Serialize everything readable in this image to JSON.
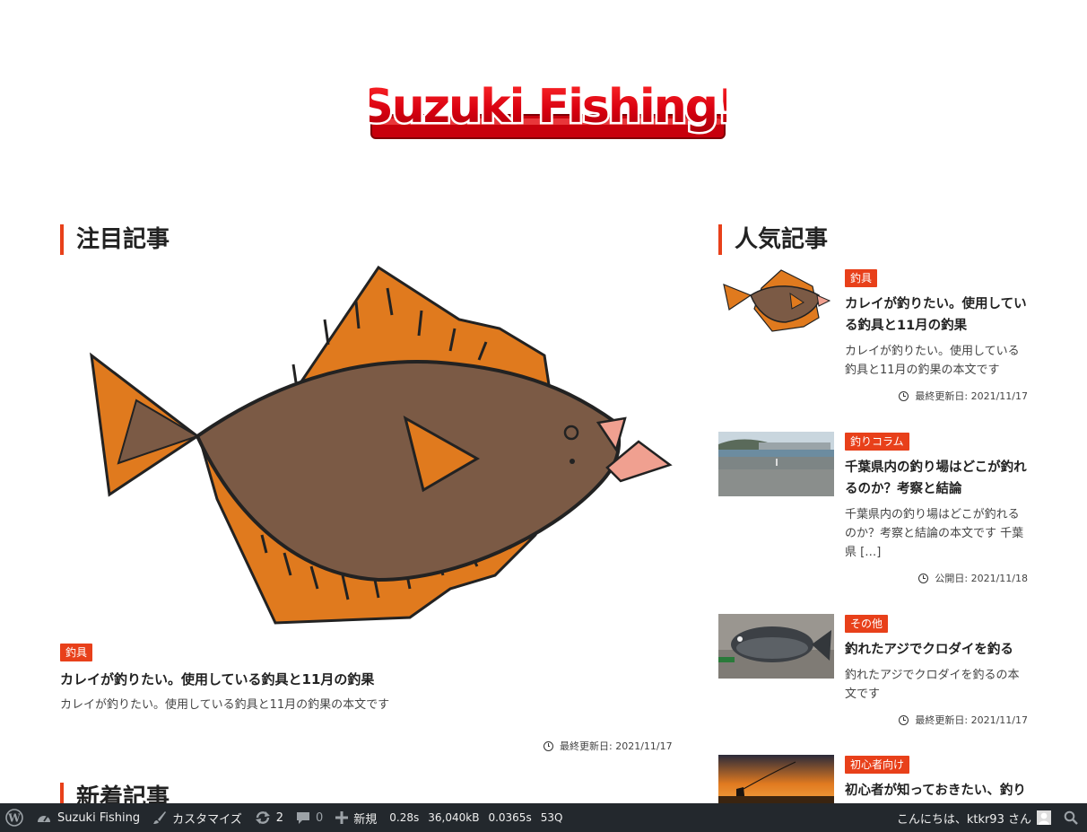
{
  "site": {
    "logo_text": "Suzuki Fishing!"
  },
  "sections": {
    "featured_heading": "注目記事",
    "popular_heading": "人気記事",
    "new_heading": "新着記事"
  },
  "featured": {
    "category": "釣具",
    "title": "カレイが釣りたい。使用している釣具と11月の釣果",
    "excerpt": "カレイが釣りたい。使用している釣具と11月の釣果の本文です",
    "date": "最終更新日: 2021/11/17",
    "image_icon": "flounder-illustration"
  },
  "popular": [
    {
      "category": "釣具",
      "title": "カレイが釣りたい。使用している釣具と11月の釣果",
      "excerpt": "カレイが釣りたい。使用している釣具と11月の釣果の本文です",
      "date": "最終更新日: 2021/11/17",
      "thumb": "flounder-thumbnail"
    },
    {
      "category": "釣りコラム",
      "title": "千葉県内の釣り場はどこが釣れるのか？考察と結論",
      "excerpt": "千葉県内の釣り場はどこが釣れるのか？考察と結論の本文です 千葉県 […]",
      "date": "公開日: 2021/11/18",
      "thumb": "pier-photo"
    },
    {
      "category": "その他",
      "title": "釣れたアジでクロダイを釣る",
      "excerpt": "釣れたアジでクロダイを釣るの本文です",
      "date": "最終更新日: 2021/11/17",
      "thumb": "black-seabream-photo"
    },
    {
      "category": "初心者向け",
      "title": "初心者が知っておきたい、釣り",
      "thumb": "sunset-fishing-photo"
    }
  ],
  "adminbar": {
    "site_name": "Suzuki Fishing",
    "customize": "カスタマイズ",
    "updates_count": "2",
    "comments_count": "0",
    "new_label": "新規",
    "stats": [
      "0.28s",
      "36,040kB",
      "0.0365s",
      "53Q"
    ],
    "greeting": "こんにちは、ktkr93 さん"
  },
  "colors": {
    "accent": "#e8401a",
    "adminbar_bg": "#23282d"
  }
}
